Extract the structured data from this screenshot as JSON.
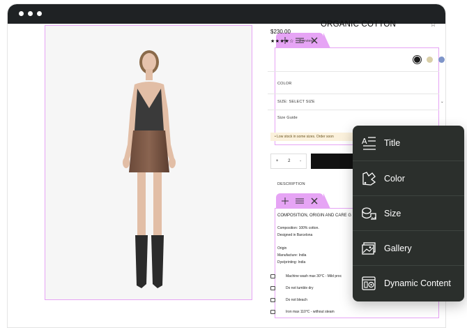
{
  "product": {
    "title": "ORGANIC COTTON",
    "price": "$230.00",
    "stars": "★★★★☆",
    "reviews": "2 reviews",
    "color_label": "COLOR",
    "size_label": "SIZE: SELECT SIZE",
    "size_guide": "Size Guide",
    "stock_notice": "•  Low stock in some sizes. Order soon",
    "quantity": "2",
    "qty_plus": "+",
    "qty_minus": "-",
    "description_label": "DESCRIPTION",
    "swatch_colors": [
      "#1a1a1a",
      "#d9cfa8",
      "#7f95c9"
    ]
  },
  "composition": {
    "heading": "COMPOSITION, ORIGIN AND CARE G",
    "composition_line": "Composition: 100% cotton.",
    "designed_line": "Designed in Barcelona",
    "origin_label": "Origin",
    "manufacture_line": "Manufacture: India",
    "dye_line": "Dye/printing: India",
    "care": [
      "Machine wash max 30°C - Mild proc",
      "Do not tumble dry",
      "Do not bleach",
      "Iron max 110°C - without steam"
    ]
  },
  "menu": {
    "items": [
      {
        "label": "Title",
        "icon": "title-icon"
      },
      {
        "label": "Color",
        "icon": "color-icon"
      },
      {
        "label": "Size",
        "icon": "size-icon"
      },
      {
        "label": "Gallery",
        "icon": "gallery-icon"
      },
      {
        "label": "Dynamic Content",
        "icon": "dynamic-content-icon"
      }
    ]
  },
  "colors": {
    "accent_pink": "#e6a4f5",
    "menu_bg": "#2b2f2c",
    "titlebar": "#1f2224"
  }
}
